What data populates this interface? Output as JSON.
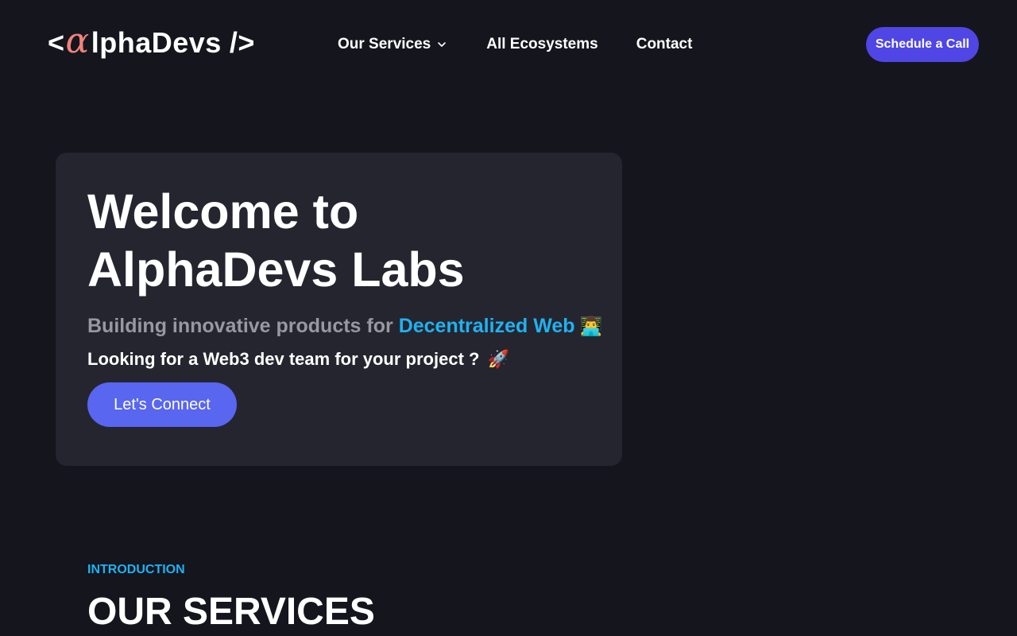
{
  "header": {
    "logo": {
      "open_bracket": "<",
      "alpha": "α",
      "rest": "lphaDevs",
      "close_bracket": "/>",
      "alpha_color": "#f0837a"
    },
    "nav": {
      "services_label": "Our Services",
      "ecosystems_label": "All Ecosystems",
      "contact_label": "Contact"
    },
    "cta_label": "Schedule a Call",
    "cta_color": "#4f46e5"
  },
  "hero": {
    "title_line1": "Welcome to",
    "title_line2": "AlphaDevs Labs",
    "subtitle_prefix": "Building innovative products for",
    "subtitle_highlight": "Decentralized Web",
    "subtitle_emoji": "👨‍💻",
    "tagline": "Looking for a Web3 dev team for your project ?",
    "tagline_emoji": "🚀",
    "button_label": "Let's Connect",
    "highlight_color": "#1fb2f0"
  },
  "intro": {
    "label": "INTRODUCTION",
    "title": "OUR SERVICES"
  }
}
